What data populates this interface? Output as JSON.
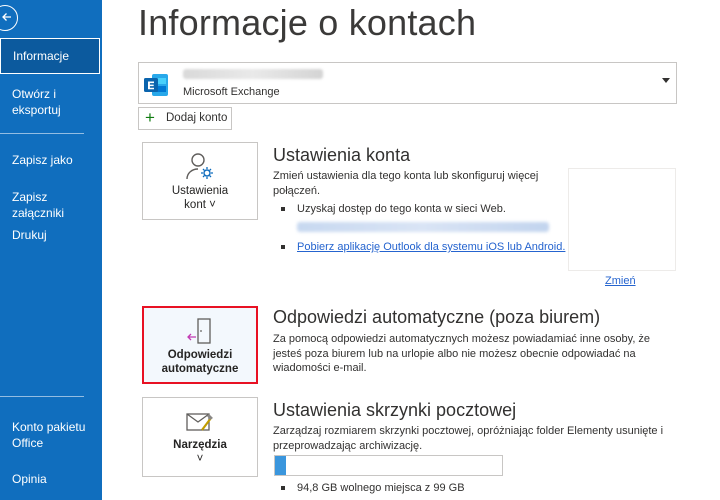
{
  "sidebar": {
    "items": [
      {
        "label": "Informacje",
        "active": true
      },
      {
        "label": "Otwórz i eksportuj"
      },
      {
        "label": "Zapisz jako"
      },
      {
        "label": "Zapisz załączniki"
      },
      {
        "label": "Drukuj"
      },
      {
        "label": "Konto pakietu Office"
      },
      {
        "label": "Opinia"
      }
    ]
  },
  "main": {
    "title": "Informacje o kontach",
    "account": {
      "type": "Microsoft Exchange"
    },
    "add_account_label": "Dodaj konto",
    "account_settings": {
      "tile_label_line1": "Ustawienia",
      "tile_label_line2": "kont ˅",
      "title": "Ustawienia konta",
      "description": "Zmień ustawienia dla tego konta lub skonfiguruj więcej połączeń.",
      "bullet1": "Uzyskaj dostęp do tego konta w sieci Web.",
      "bullet2_link": "Pobierz aplikację Outlook dla systemu iOS lub Android.",
      "change_link": "Zmień"
    },
    "auto_replies": {
      "tile_label_line1": "Odpowiedzi",
      "tile_label_line2": "automatyczne",
      "title": "Odpowiedzi automatyczne (poza biurem)",
      "description": "Za pomocą odpowiedzi automatycznych możesz powiadamiać inne osoby, że jesteś poza biurem lub na urlopie albo nie możesz obecnie odpowiadać na wiadomości e-mail."
    },
    "mailbox": {
      "tile_label": "Narzędzia",
      "tile_caret": "˅",
      "title": "Ustawienia skrzynki pocztowej",
      "description": "Zarządzaj rozmiarem skrzynki pocztowej, opróżniając folder Elementy usunięte i przeprowadzając archiwizację.",
      "usage_fraction": 0.05,
      "free_space": "94,8 GB wolnego miejsca z 99 GB"
    }
  },
  "colors": {
    "sidebar_bg": "#106ebe",
    "accent_link": "#2564cf",
    "highlight_border": "#e81123",
    "progress_fill": "#3a96dd"
  },
  "icons": [
    "back-arrow-icon",
    "exchange-icon",
    "plus-icon",
    "account-gear-icon",
    "door-arrow-icon",
    "mailbox-tools-icon",
    "dropdown-caret-icon"
  ]
}
